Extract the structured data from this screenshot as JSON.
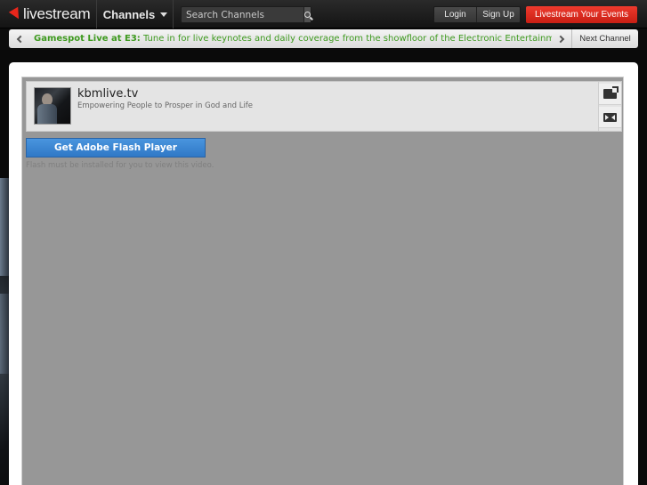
{
  "header": {
    "logo_text": "livestream",
    "channels_label": "Channels",
    "search": {
      "placeholder": "Search Channels",
      "value": ""
    },
    "login_label": "Login",
    "signup_label": "Sign Up",
    "events_label": "Livestream Your Events"
  },
  "ticker": {
    "headline": "Gamespot Live at E3:",
    "body": "Tune in for live keynotes and daily coverage from the showfloor of the Electronic Entertainment Expo!",
    "next_label": "Next Channel"
  },
  "channel": {
    "name": "kbmlive.tv",
    "tagline": "Empowering People to Prosper in God and Life"
  },
  "player": {
    "flash_button_label": "Get Adobe Flash Player",
    "flash_note": "Flash must be installed for you to view this video."
  },
  "colors": {
    "brand_red": "#e8261b",
    "ticker_green": "#3e9a1f",
    "flash_blue": "#3a86d4",
    "player_gray": "#979797"
  }
}
